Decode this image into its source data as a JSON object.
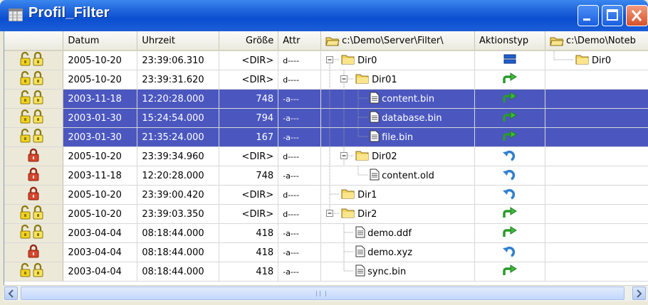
{
  "window": {
    "title": "Profil_Filter"
  },
  "columns": {
    "date": "Datum",
    "time": "Uhrzeit",
    "size": "Größe",
    "attr": "Attr",
    "path_left": "c:\\Demo\\Server\\Filter\\",
    "action": "Aktionstyp",
    "path_right": "c:\\Demo\\Noteb"
  },
  "rows": [
    {
      "status": "unlocked-icon",
      "date": "2005-10-20",
      "time": "23:39:06.310",
      "size": "<DIR>",
      "attr": "d----",
      "name": "Dir0",
      "node": "folder",
      "action": "equal-icon",
      "right": "Dir0",
      "selected": false
    },
    {
      "status": "unlocked-icon",
      "date": "2005-10-20",
      "time": "23:39:31.620",
      "size": "<DIR>",
      "attr": "d----",
      "name": "Dir01",
      "node": "folder",
      "action": "arrow-right-icon",
      "right": "",
      "selected": false
    },
    {
      "status": "unlocked-icon",
      "date": "2003-11-18",
      "time": "12:20:28.000",
      "size": "748",
      "attr": "-a---",
      "name": "content.bin",
      "node": "file",
      "action": "arrow-right-icon",
      "right": "",
      "selected": true
    },
    {
      "status": "unlocked-icon",
      "date": "2003-01-30",
      "time": "15:24:54.000",
      "size": "794",
      "attr": "-a---",
      "name": "database.bin",
      "node": "file",
      "action": "arrow-right-icon",
      "right": "",
      "selected": true
    },
    {
      "status": "unlocked-icon",
      "date": "2003-01-30",
      "time": "21:35:24.000",
      "size": "167",
      "attr": "-a---",
      "name": "file.bin",
      "node": "file",
      "action": "arrow-right-icon",
      "right": "",
      "selected": true
    },
    {
      "status": "locked-icon",
      "date": "2005-10-20",
      "time": "23:39:34.960",
      "size": "<DIR>",
      "attr": "d----",
      "name": "Dir02",
      "node": "folder",
      "action": "undo-icon",
      "right": "",
      "selected": false
    },
    {
      "status": "locked-icon",
      "date": "2003-11-18",
      "time": "12:20:28.000",
      "size": "748",
      "attr": "-a---",
      "name": "content.old",
      "node": "file",
      "action": "undo-icon",
      "right": "",
      "selected": false
    },
    {
      "status": "locked-icon",
      "date": "2005-10-20",
      "time": "23:39:00.420",
      "size": "<DIR>",
      "attr": "d----",
      "name": "Dir1",
      "node": "folder",
      "action": "undo-icon",
      "right": "",
      "selected": false
    },
    {
      "status": "unlocked-icon",
      "date": "2005-10-20",
      "time": "23:39:03.350",
      "size": "<DIR>",
      "attr": "d----",
      "name": "Dir2",
      "node": "folder",
      "action": "arrow-right-icon",
      "right": "",
      "selected": false
    },
    {
      "status": "unlocked-icon",
      "date": "2003-04-04",
      "time": "08:18:44.000",
      "size": "418",
      "attr": "-a---",
      "name": "demo.ddf",
      "node": "file",
      "action": "arrow-right-icon",
      "right": "",
      "selected": false
    },
    {
      "status": "locked-icon",
      "date": "2003-04-04",
      "time": "08:18:44.000",
      "size": "418",
      "attr": "-a---",
      "name": "demo.xyz",
      "node": "file",
      "action": "undo-icon",
      "right": "",
      "selected": false
    },
    {
      "status": "unlocked-icon",
      "date": "2003-04-04",
      "time": "08:18:44.000",
      "size": "418",
      "attr": "-a---",
      "name": "sync.bin",
      "node": "file",
      "action": "arrow-right-icon",
      "right": "",
      "selected": false
    }
  ],
  "scrollbar": {
    "grip": "III"
  },
  "colors": {
    "title_bar": "#0a4fd1",
    "selection": "#4b57bf",
    "folder": "#f4d35e",
    "arrow_green": "#3cb93c",
    "undo_blue": "#2f7fd0"
  }
}
